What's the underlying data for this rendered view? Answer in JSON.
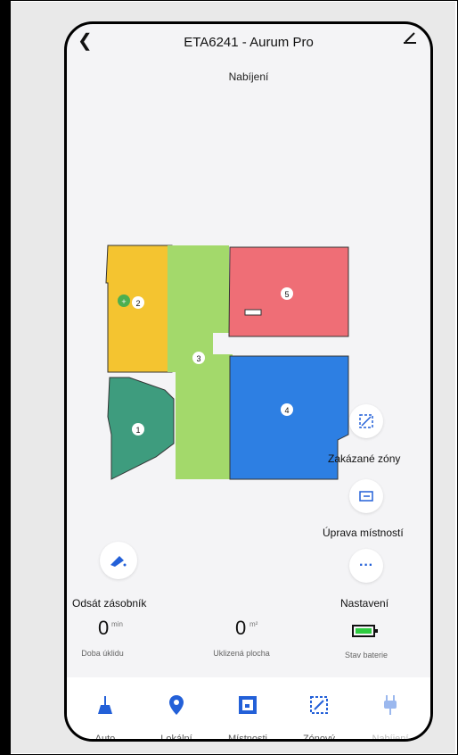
{
  "header": {
    "title": "ETA6241 - Aurum Pro",
    "status": "Nabíjení"
  },
  "map": {
    "room_labels": [
      "1",
      "2",
      "3",
      "4",
      "5"
    ],
    "room_colors": {
      "1": "#3e9c7e",
      "2": "#f4c430",
      "3": "#a3d96b",
      "4": "#2d7fe3",
      "5": "#ef6e76"
    }
  },
  "side_buttons": {
    "forbidden_zones": "Zakázané zóny",
    "room_edit": "Úprava místností",
    "settings": "Nastavení"
  },
  "dust_button": {
    "label": "Odsát zásobník"
  },
  "stats": {
    "time": {
      "value": "0",
      "unit": "min",
      "label": "Doba úklidu"
    },
    "area": {
      "value": "0",
      "unit": "m²",
      "label": "Uklizená plocha"
    },
    "battery": {
      "label": "Stav baterie"
    }
  },
  "tabs": [
    "Auto",
    "Lokální",
    "Místnosti",
    "Zónový",
    "Nabíjení"
  ],
  "colors": {
    "accent": "#2360d8",
    "battery": "#2ecc40"
  }
}
